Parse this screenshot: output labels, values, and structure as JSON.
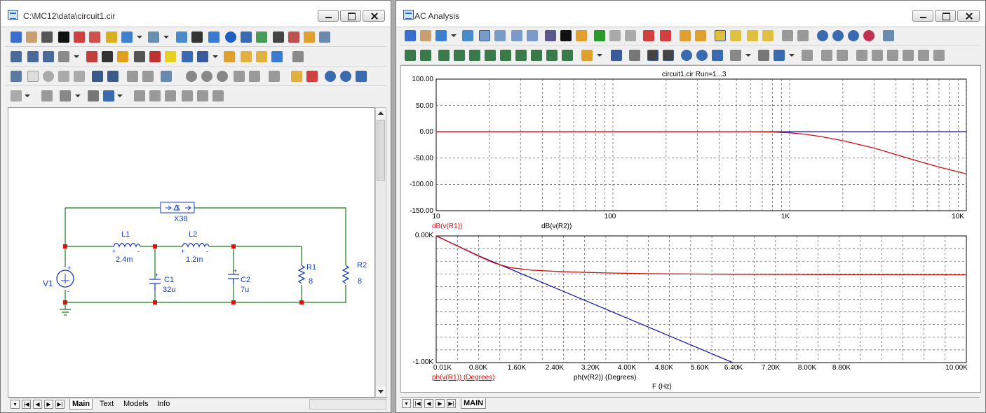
{
  "left_window": {
    "title": "C:\\MC12\\data\\circuit1.cir",
    "tabs": [
      "Main",
      "Text",
      "Models",
      "Info"
    ],
    "components": {
      "L1": {
        "name": "L1",
        "value": "2.4m"
      },
      "L2": {
        "name": "L2",
        "value": "1.2m"
      },
      "C1": {
        "name": "C1",
        "value": "32u"
      },
      "C2": {
        "name": "C2",
        "value": "7u"
      },
      "R1": {
        "name": "R1",
        "value": "8"
      },
      "R2": {
        "name": "R2",
        "value": "8"
      },
      "V1": {
        "name": "V1"
      },
      "X38": {
        "name": "X38",
        "symbol": "T"
      }
    },
    "pin_plus": "+",
    "pin_minus": "-"
  },
  "right_window": {
    "title": "AC Analysis",
    "tabs": [
      "MAIN"
    ],
    "plot1": {
      "title": "circuit1.cir Run=1...3",
      "y_ticks": [
        "100.00",
        "50.00",
        "0.00",
        "-50.00",
        "-100.00",
        "-150.00"
      ],
      "x_ticks": [
        "10",
        "100",
        "1K",
        "10K"
      ],
      "trace_labels": [
        "dB(v(R1))",
        "dB(v(R2))"
      ]
    },
    "plot2": {
      "y_ticks": [
        "0.00K",
        "-1.00K"
      ],
      "x_ticks": [
        "0.01K",
        "0.80K",
        "1.60K",
        "2.40K",
        "3.20K",
        "4.00K",
        "4.80K",
        "5.60K",
        "6.40K",
        "7.20K",
        "8.00K",
        "8.80K",
        "10.00K"
      ],
      "trace_labels": [
        "ph(v(R1)) (Degrees)",
        "ph(v(R2)) (Degrees)"
      ],
      "xlabel": "F (Hz)"
    }
  },
  "colors": {
    "trace_red": "#cc1010",
    "trace_blue": "#1a1aa8",
    "wire_green": "#1a7a1a",
    "component_blue": "#1a3fbf",
    "node_red": "#e01010"
  },
  "chart_data": [
    {
      "type": "line",
      "title": "circuit1.cir Run=1...3",
      "x_scale": "log",
      "xlim": [
        10,
        10000
      ],
      "ylim": [
        -150,
        100
      ],
      "series": [
        {
          "name": "dB(v(R1))",
          "color": "#cc1010",
          "x": [
            10,
            100,
            600,
            800,
            1000,
            1200,
            1500,
            2000,
            3000,
            5000,
            7000,
            10000
          ],
          "values": [
            0,
            0,
            0,
            -0.5,
            -2,
            -4.5,
            -9,
            -17,
            -31,
            -53,
            -67,
            -80
          ]
        },
        {
          "name": "dB(v(R2))",
          "color": "#1a1aa8",
          "x": [
            10,
            100,
            1000,
            10000
          ],
          "values": [
            0,
            0,
            0,
            0
          ]
        }
      ]
    },
    {
      "type": "line",
      "xlabel": "F (Hz)",
      "x_scale": "linear",
      "xlim": [
        10,
        10000
      ],
      "ylim": [
        -1000,
        0
      ],
      "series": [
        {
          "name": "ph(v(R1)) (Degrees)",
          "color": "#cc1010",
          "x": [
            10,
            400,
            800,
            1100,
            1400,
            1800,
            2400,
            3200,
            4000,
            5600,
            7200,
            8800,
            10000
          ],
          "values": [
            0,
            -78,
            -158,
            -213,
            -250,
            -270,
            -283,
            -292,
            -298,
            -303,
            -305,
            -306,
            -307
          ]
        },
        {
          "name": "ph(v(R2)) (Degrees)",
          "color": "#1a1aa8",
          "x": [
            10,
            800,
            1100,
            5600
          ],
          "values": [
            0,
            -155,
            -208,
            -1000
          ]
        }
      ]
    }
  ]
}
